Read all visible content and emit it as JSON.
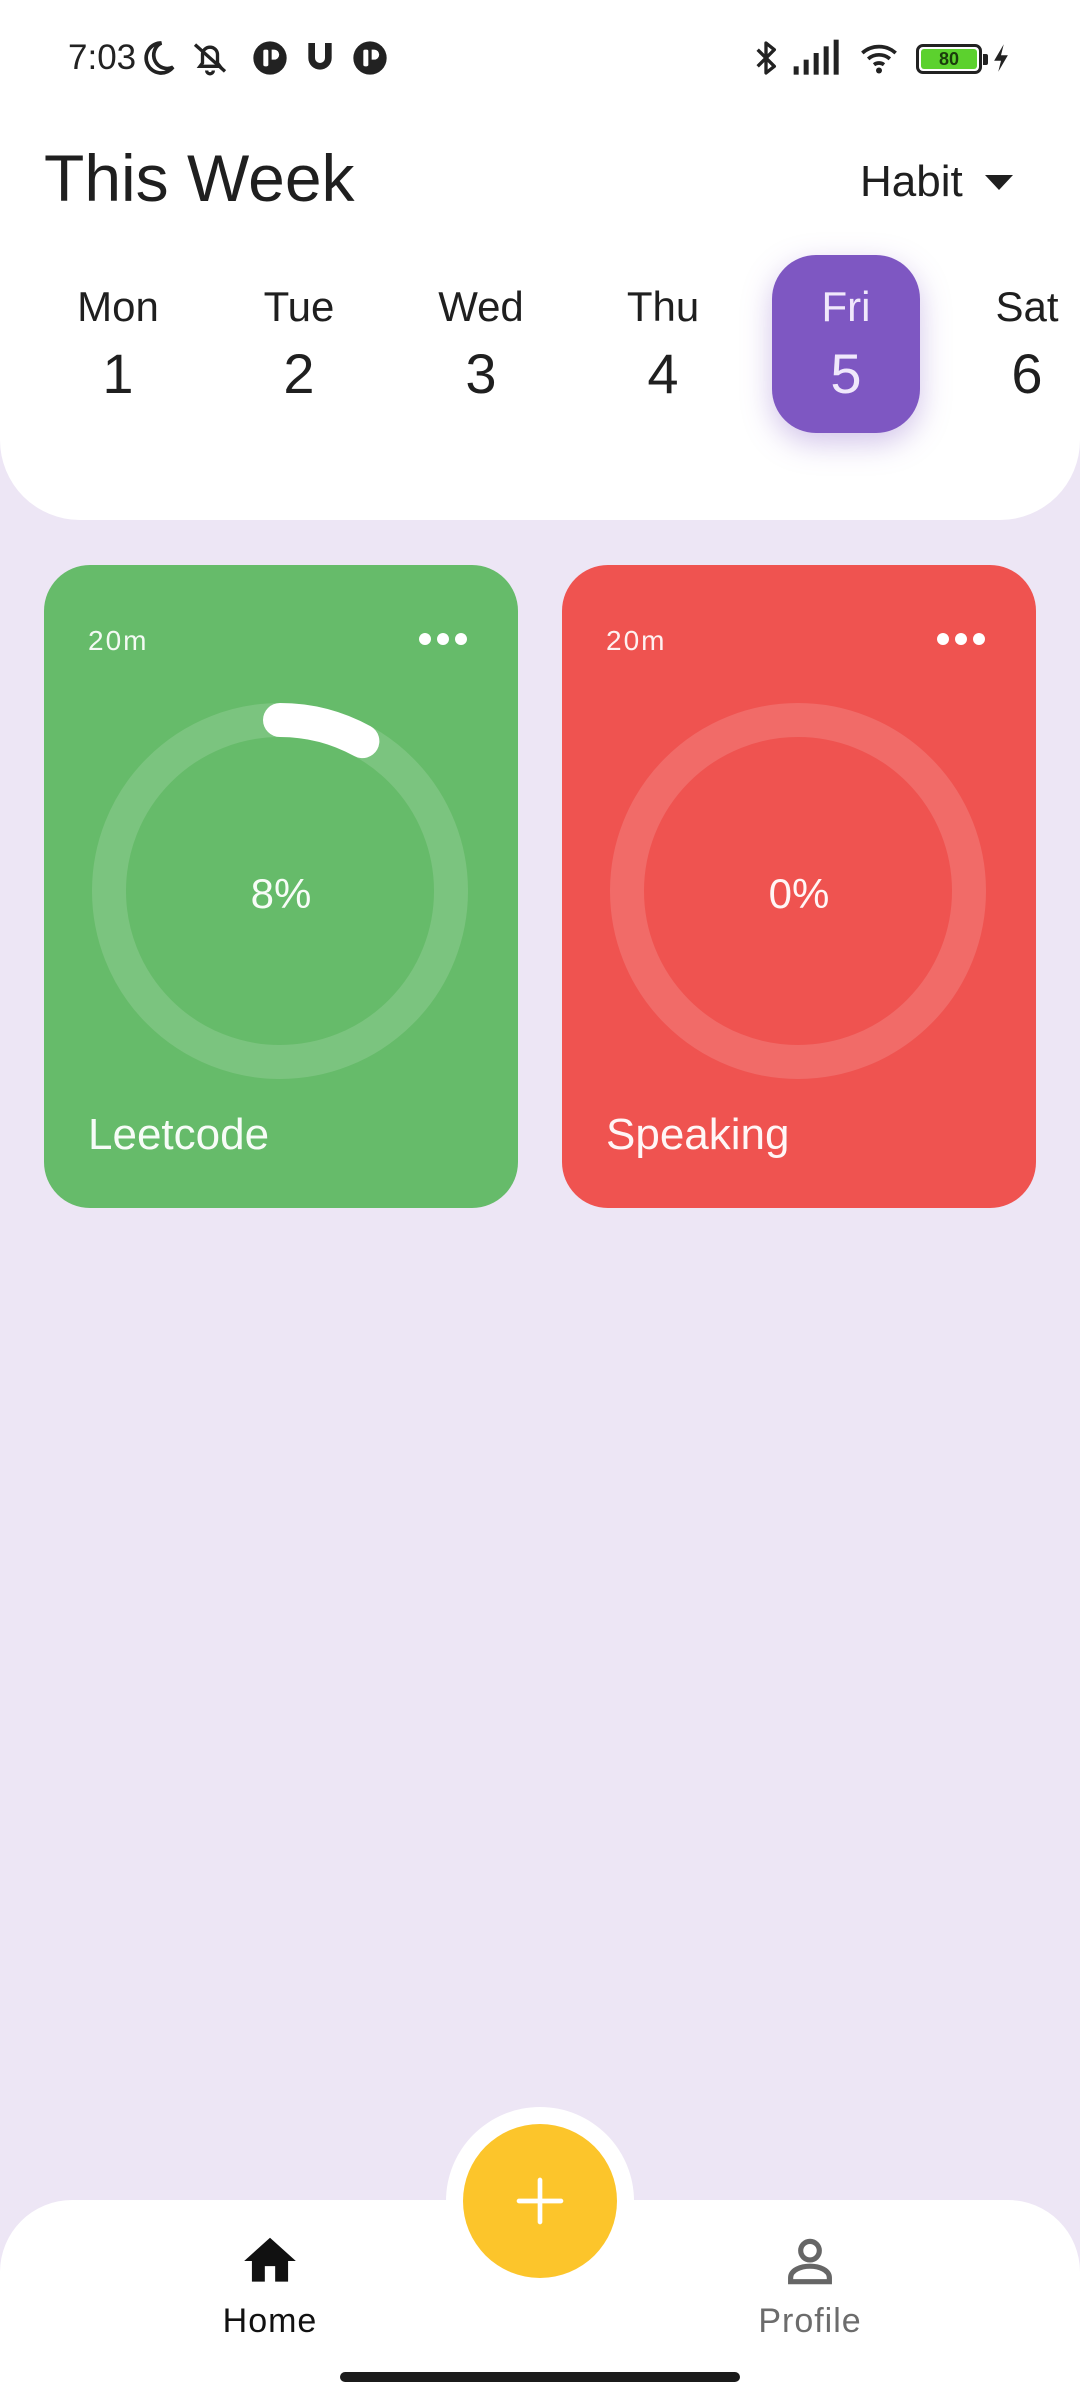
{
  "status_bar": {
    "time": "7:03",
    "battery_level": "80",
    "icons": [
      "moon-icon",
      "alarm-off-icon",
      "app-badge-icon",
      "magnet-icon",
      "app-badge-icon",
      "bluetooth-icon",
      "signal-icon",
      "wifi-icon",
      "battery-icon",
      "charging-icon"
    ]
  },
  "header": {
    "title": "This Week",
    "filter_label": "Habit"
  },
  "days": [
    {
      "name": "Mon",
      "num": "1"
    },
    {
      "name": "Tue",
      "num": "2"
    },
    {
      "name": "Wed",
      "num": "3"
    },
    {
      "name": "Thu",
      "num": "4"
    },
    {
      "name": "Fri",
      "num": "5",
      "selected": true
    },
    {
      "name": "Sat",
      "num": "6"
    }
  ],
  "habits": [
    {
      "name": "Leetcode",
      "duration": "20m",
      "percent_label": "8%",
      "progress": 0.08,
      "color": "#66bb6a"
    },
    {
      "name": "Speaking",
      "duration": "20m",
      "percent_label": "0%",
      "progress": 0,
      "color": "#ef5350"
    }
  ],
  "nav": {
    "home_label": "Home",
    "profile_label": "Profile"
  },
  "colors": {
    "accent": "#7e57c2",
    "background": "#ede6f5",
    "fab": "#fcc52b"
  }
}
